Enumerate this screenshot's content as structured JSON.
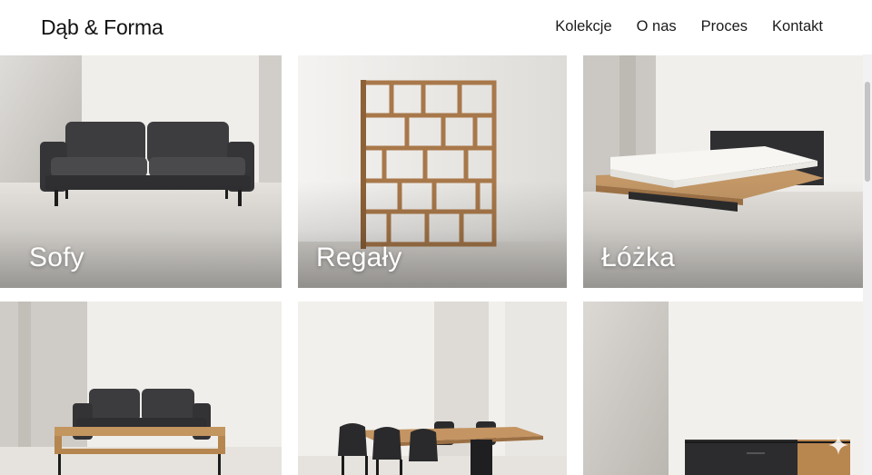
{
  "brand": {
    "name": "Dąb & Forma"
  },
  "nav": {
    "items": [
      {
        "label": "Kolekcje"
      },
      {
        "label": "O nas"
      },
      {
        "label": "Proces"
      },
      {
        "label": "Kontakt"
      }
    ]
  },
  "categories": [
    {
      "label": "Sofy",
      "image": "grey-sofa-photo"
    },
    {
      "label": "Regały",
      "image": "oak-bookshelf-photo"
    },
    {
      "label": "Łóżka",
      "image": "platform-bed-photo"
    },
    {
      "label": "",
      "image": "sofa-and-coffee-table-photo"
    },
    {
      "label": "",
      "image": "dining-table-photo"
    },
    {
      "label": "",
      "image": "sideboard-photo"
    }
  ],
  "colors": {
    "background": "#ffffff",
    "text": "#111111",
    "concrete": "#c9c6c1",
    "oak": "#b98a57",
    "charcoal": "#3b3b3d"
  },
  "icons": {
    "corner": "sparkle-icon"
  }
}
